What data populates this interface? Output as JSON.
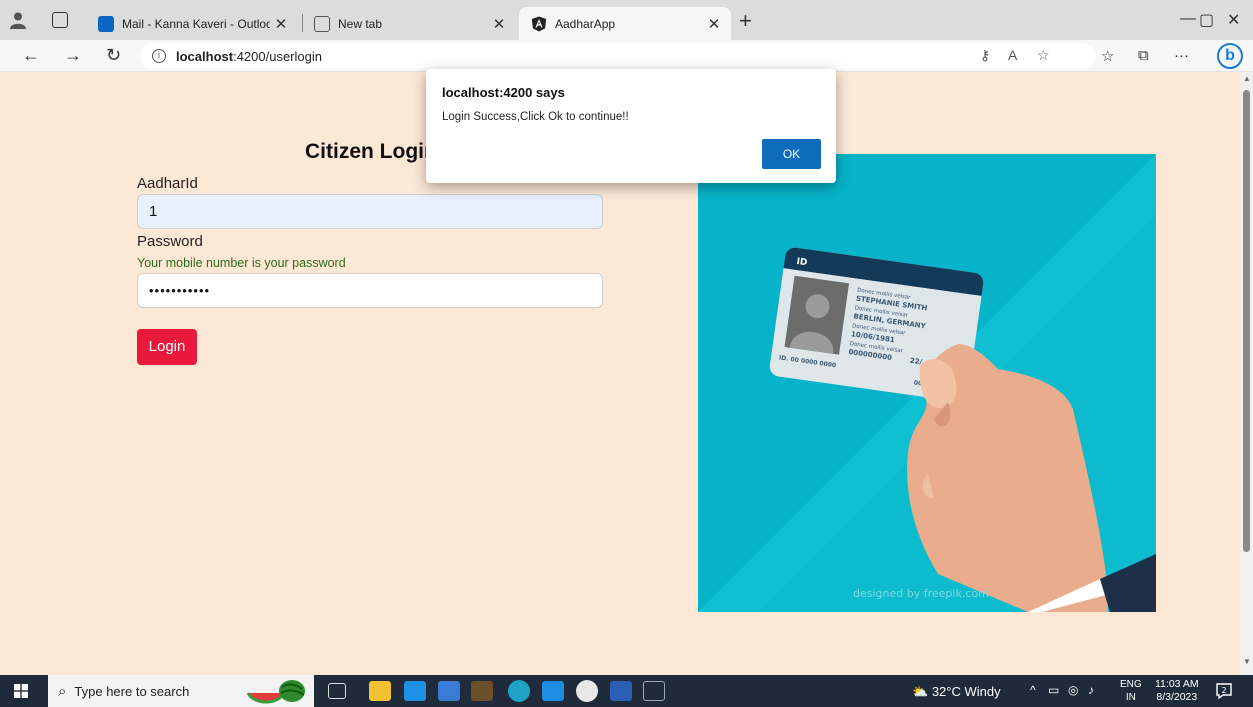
{
  "browser": {
    "tabs": [
      {
        "title": "Mail - Kanna Kaveri - Outlook",
        "close": "✕"
      },
      {
        "title": "New tab",
        "close": "✕"
      },
      {
        "title": "AadharApp",
        "close": "✕"
      }
    ],
    "new_tab": "+",
    "window_controls": {
      "minimize": "—",
      "restore": "▢",
      "close": "✕"
    },
    "url_host": "localhost",
    "url_path": ":4200/userlogin",
    "info_icon": "i"
  },
  "page": {
    "title": "Citizen Login",
    "aadhar_label": "AadharId",
    "aadhar_value": "1",
    "password_label": "Password",
    "password_hint": "Your mobile number is your password",
    "password_value": "•••••••••••",
    "login_button": "Login"
  },
  "illustration": {
    "card_header": "ID",
    "card_lines": [
      "Donec mollis velsar",
      "STEPHANIE SMITH",
      "Donec mollis velsar",
      "BERLIN, GERMANY",
      "Donec mollis velsar",
      "10/06/1981",
      "Donec mollis velsar",
      "000000000",
      "22/"
    ],
    "card_id": "ID. 00 0000 0000",
    "card_code": "000000",
    "credit": "designed by freepik.com"
  },
  "alert": {
    "title": "localhost:4200 says",
    "message": "Login Success,Click Ok to continue!!",
    "ok_button": "OK"
  },
  "taskbar": {
    "search_placeholder": "Type here to search",
    "weather": "32°C  Windy",
    "lang_top": "ENG",
    "lang_bottom": "IN",
    "time": "11:03 AM",
    "date": "8/3/2023",
    "notification_count": "2"
  }
}
